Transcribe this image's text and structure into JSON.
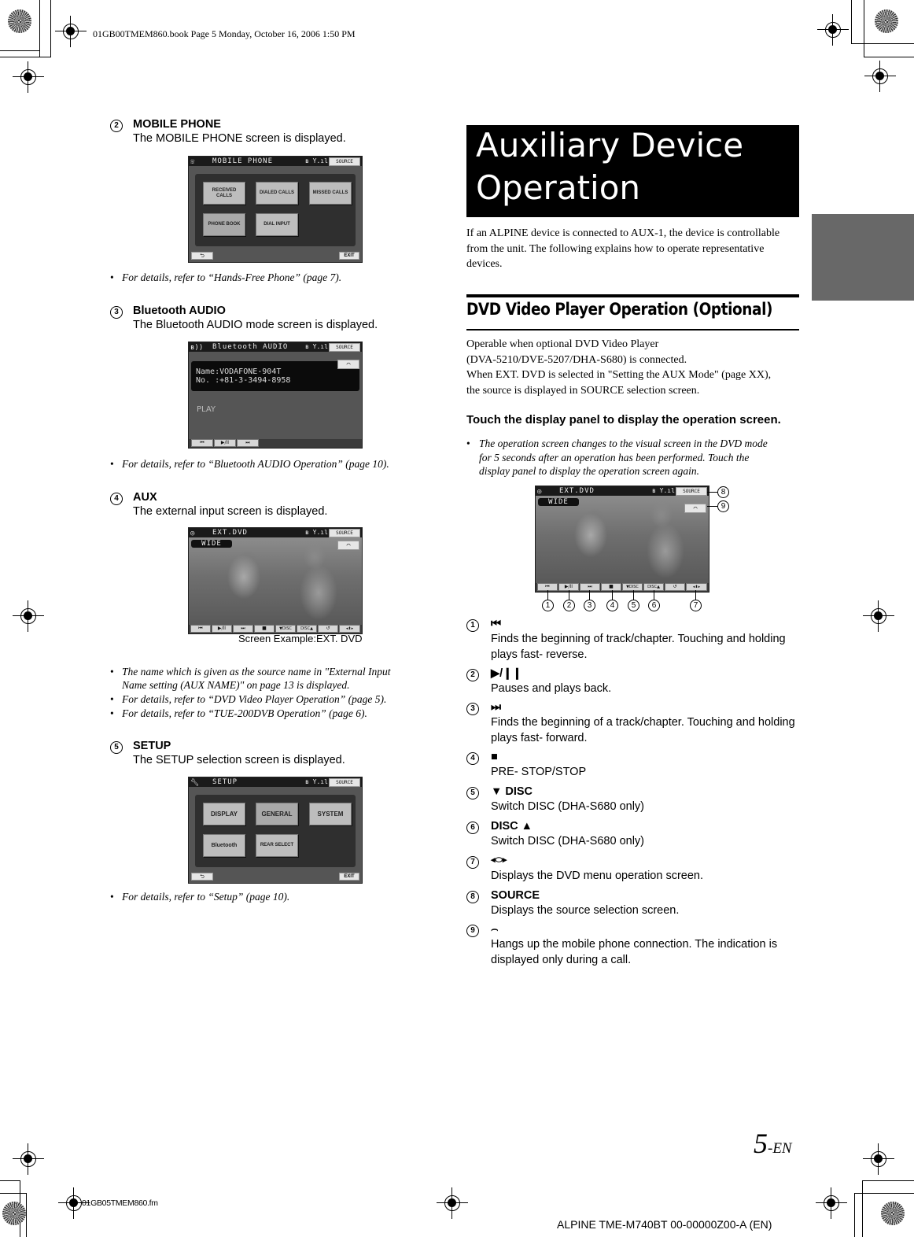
{
  "print_header": "01GB00TMEM860.book  Page 5  Monday, October 16, 2006  1:50 PM",
  "left_column": {
    "items": [
      {
        "number": "2",
        "title": "MOBILE PHONE",
        "description": "The MOBILE PHONE screen is displayed.",
        "screen": {
          "title": "MOBILE PHONE",
          "source_label": "SOURCE",
          "buttons": [
            "RECEIVED CALLS",
            "DIALED CALLS",
            "MISSED CALLS",
            "PHONE BOOK",
            "DIAL INPUT"
          ],
          "exit_label": "EXIT"
        },
        "notes": [
          "For details, refer to “Hands-Free Phone” (page 7)."
        ]
      },
      {
        "number": "3",
        "title": "Bluetooth AUDIO",
        "description": "The Bluetooth AUDIO mode screen is displayed.",
        "screen": {
          "title": "Bluetooth AUDIO",
          "source_label": "SOURCE",
          "name_line": "Name:VODAFONE-904T",
          "number_line": "No.  :+81-3-3494-8958",
          "status": "PLAY",
          "controls": [
            "⏮",
            "▶/II",
            "⏭"
          ]
        },
        "notes": [
          "For details, refer to “Bluetooth AUDIO Operation” (page 10)."
        ]
      },
      {
        "number": "4",
        "title": "AUX",
        "description": "The external input screen is displayed.",
        "screen": {
          "title": "EXT.DVD",
          "source_label": "SOURCE",
          "mode_label": "WIDE",
          "controls": [
            "⏮",
            "▶/II",
            "⏭",
            "■",
            "▼DISC",
            "DISC▲",
            "↺",
            "◂⬍▸"
          ]
        },
        "caption": "Screen Example:EXT. DVD",
        "notes": [
          " The name which is given as the source name in \"External Input",
          "Name setting (AUX NAME)\" on page 13 is displayed.",
          "For details, refer to “DVD Video Player Operation” (page 5).",
          "For details, refer to “TUE-200DVB Operation” (page 6)."
        ]
      },
      {
        "number": "5",
        "title": "SETUP",
        "description": "The SETUP selection screen is displayed.",
        "screen": {
          "title": "SETUP",
          "source_label": "SOURCE",
          "buttons": [
            "DISPLAY",
            "GENERAL",
            "SYSTEM",
            "Bluetooth",
            "REAR SELECT"
          ],
          "exit_label": "EXIT"
        },
        "notes": [
          "For details, refer to “Setup” (page 10)."
        ]
      }
    ]
  },
  "right_column": {
    "banner_line1": "Auxiliary Device",
    "banner_line2": "Operation",
    "intro": [
      "If an ALPINE device is connected to AUX-1, the device is controllable",
      "from the unit. The following explains how to operate representative",
      "devices."
    ],
    "section_title": "DVD Video Player Operation (Optional)",
    "section_body": [
      "Operable when optional DVD Video Player",
      "(DVA-5210/DVE-5207/DHA-S680) is connected.",
      "When EXT. DVD is selected in \"Setting the AUX Mode\" (page XX),",
      "the source is displayed in SOURCE selection screen."
    ],
    "subheading": "Touch the display panel to display the operation screen.",
    "note_lines": [
      "The operation screen changes to the visual screen in the DVD mode",
      "for 5 seconds after an operation has been performed. Touch the",
      "display panel to display the operation screen again."
    ],
    "screen": {
      "title": "EXT.DVD",
      "source_label": "SOURCE",
      "mode_label": "WIDE",
      "controls": [
        "⏮",
        "▶/II",
        "⏭",
        "■",
        "▼DISC",
        "DISC▲",
        "↺",
        "◂⬍▸"
      ],
      "callouts": [
        "1",
        "2",
        "3",
        "4",
        "5",
        "6",
        "7",
        "8",
        "9"
      ]
    },
    "descriptions": [
      {
        "number": "1",
        "symbol": "⏮",
        "text": "Finds the beginning of track/chapter. Touching and holding plays fast- reverse."
      },
      {
        "number": "2",
        "symbol": "▶/❙❙",
        "text": "Pauses and plays back."
      },
      {
        "number": "3",
        "symbol": "⏭",
        "text": "Finds the beginning of a track/chapter. Touching and holding plays fast- forward."
      },
      {
        "number": "4",
        "symbol": "■",
        "text": "PRE- STOP/STOP"
      },
      {
        "number": "5",
        "symbol": "▼ DISC",
        "text": "Switch DISC (DHA-S680 only)"
      },
      {
        "number": "6",
        "symbol": "DISC ▲",
        "text": "Switch DISC (DHA-S680 only)"
      },
      {
        "number": "7",
        "symbol": "◂⬭▸",
        "text": "Displays the DVD menu operation screen."
      },
      {
        "number": "8",
        "symbol": "SOURCE",
        "text": "Displays the source selection screen."
      },
      {
        "number": "9",
        "symbol": "⌢",
        "text": "Hangs up the mobile phone connection. The indication is displayed only during a call."
      }
    ]
  },
  "footer": {
    "page_number": "5",
    "page_suffix": "-EN",
    "file_name": "01GB05TMEM860.fm",
    "doc_code": "ALPINE TME-M740BT 00-00000Z00-A (EN)"
  }
}
